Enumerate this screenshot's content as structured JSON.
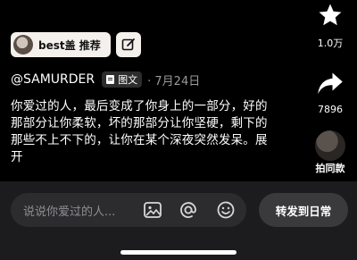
{
  "top": {
    "pill_label": "best盖 推荐",
    "edit_icon": "edit-square-icon"
  },
  "side": {
    "like_count": "1.0万",
    "share_count": "7896",
    "remix_label": "拍同款"
  },
  "post": {
    "author": "@SAMURDER",
    "tag": "图文",
    "date": "· 7月24日",
    "caption": "你爱过的人，最后变成了你身上的一部分，好的那部分让你柔软，坏的那部分让你坚硬，剩下的那些不上不下的，让你在某个深夜突然发呆。展开"
  },
  "comment": {
    "placeholder": "说说你爱过的人...",
    "forward_label": "转发到日常"
  }
}
